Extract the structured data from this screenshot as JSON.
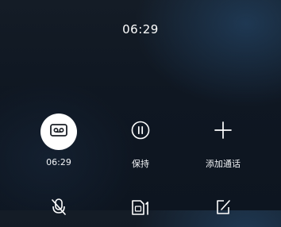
{
  "call": {
    "duration": "06:29"
  },
  "controls": [
    {
      "id": "record",
      "icon": "cassette-tape-icon",
      "label": "06:29",
      "active": true
    },
    {
      "id": "hold",
      "icon": "pause-circle-icon",
      "label": "保持",
      "active": false
    },
    {
      "id": "add-call",
      "icon": "plus-icon",
      "label": "添加通话",
      "active": false
    },
    {
      "id": "mute",
      "icon": "microphone-off-icon",
      "label": "",
      "active": false
    },
    {
      "id": "sim",
      "icon": "sim-card-1-icon",
      "label": "",
      "active": false
    },
    {
      "id": "notes",
      "icon": "edit-note-icon",
      "label": "",
      "active": false
    }
  ],
  "colors": {
    "active_button_bg": "#ffffff",
    "icon_dark": "#1a1f26",
    "icon_light": "#ffffff"
  }
}
